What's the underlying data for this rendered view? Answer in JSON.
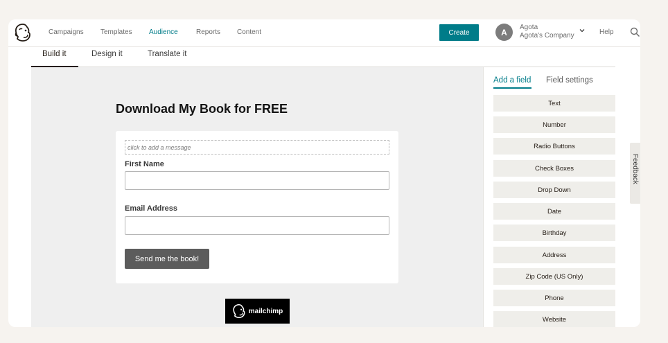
{
  "nav": {
    "links": [
      "Campaigns",
      "Templates",
      "Audience",
      "Reports",
      "Content"
    ],
    "active": "Audience",
    "create_label": "Create",
    "avatar_initial": "A",
    "account_name": "Agota",
    "account_company": "Agota's Company",
    "help_label": "Help",
    "accent_color": "#007c89"
  },
  "tabs": [
    "Build it",
    "Design it",
    "Translate it"
  ],
  "form": {
    "title": "Download My Book for FREE",
    "message_placeholder": "click to add a message",
    "field1_label": "First Name",
    "field2_label": "Email Address",
    "submit_label": "Send me the book!",
    "badge_text": "mailchimp"
  },
  "panel": {
    "tabs": [
      "Add a field",
      "Field settings"
    ],
    "fields": [
      "Text",
      "Number",
      "Radio Buttons",
      "Check Boxes",
      "Drop Down",
      "Date",
      "Birthday",
      "Address",
      "Zip Code (US Only)",
      "Phone",
      "Website"
    ]
  },
  "feedback_label": "Feedback"
}
